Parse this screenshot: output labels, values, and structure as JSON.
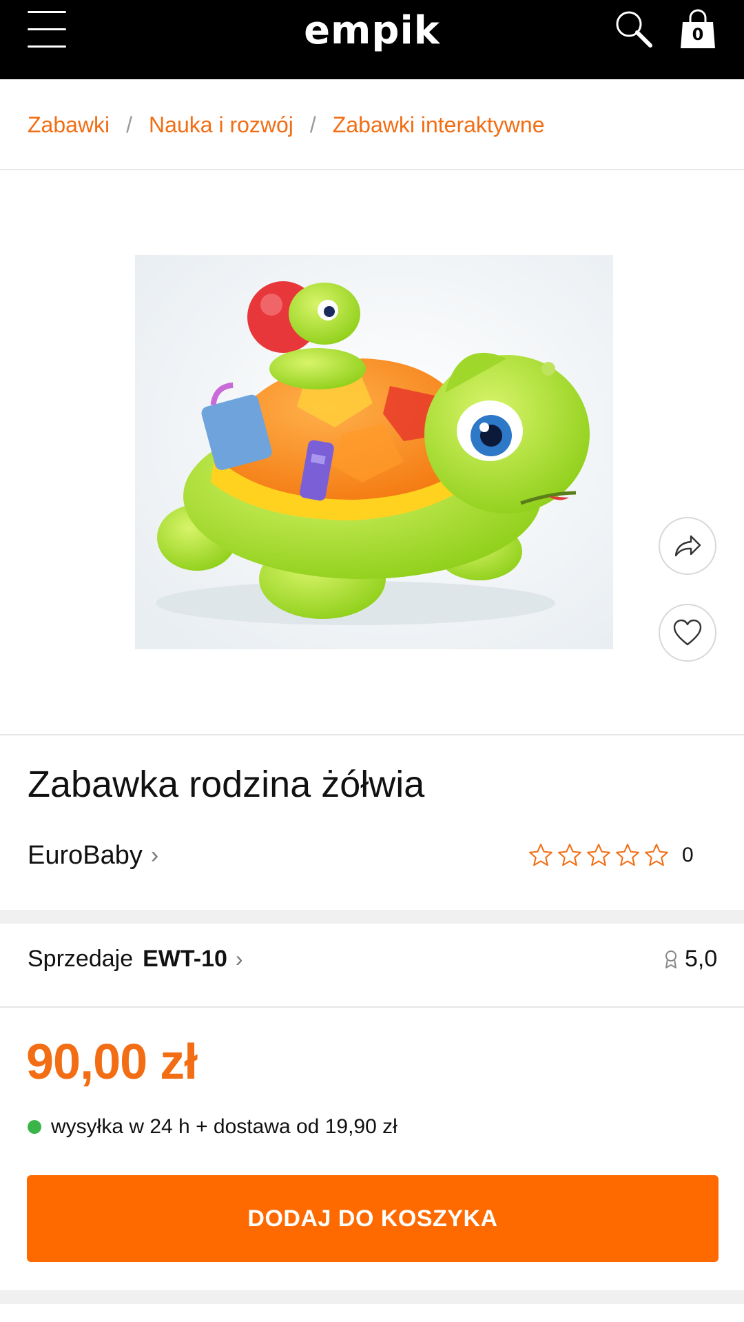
{
  "header": {
    "logo_text": "empik",
    "cart_count": "0"
  },
  "breadcrumb": {
    "items": [
      "Zabawki",
      "Nauka i rozwój",
      "Zabawki interaktywne"
    ],
    "separator": "/"
  },
  "product": {
    "title": "Zabawka rodzina żółwia",
    "brand": "EuroBaby",
    "rating_count": "0",
    "stars": 0,
    "stars_max": 5
  },
  "seller": {
    "label": "Sprzedaje",
    "name": "EWT-10",
    "rating": "5,0"
  },
  "pricing": {
    "price": "90,00 zł",
    "delivery": "wysyłka w 24 h + dostawa od 19,90 zł"
  },
  "actions": {
    "add_to_cart": "DODAJ DO KOSZYKA"
  },
  "colors": {
    "accent": "#f26d13",
    "button": "#ff6a00",
    "availability": "#3bb54a",
    "header_bg": "#000000"
  }
}
